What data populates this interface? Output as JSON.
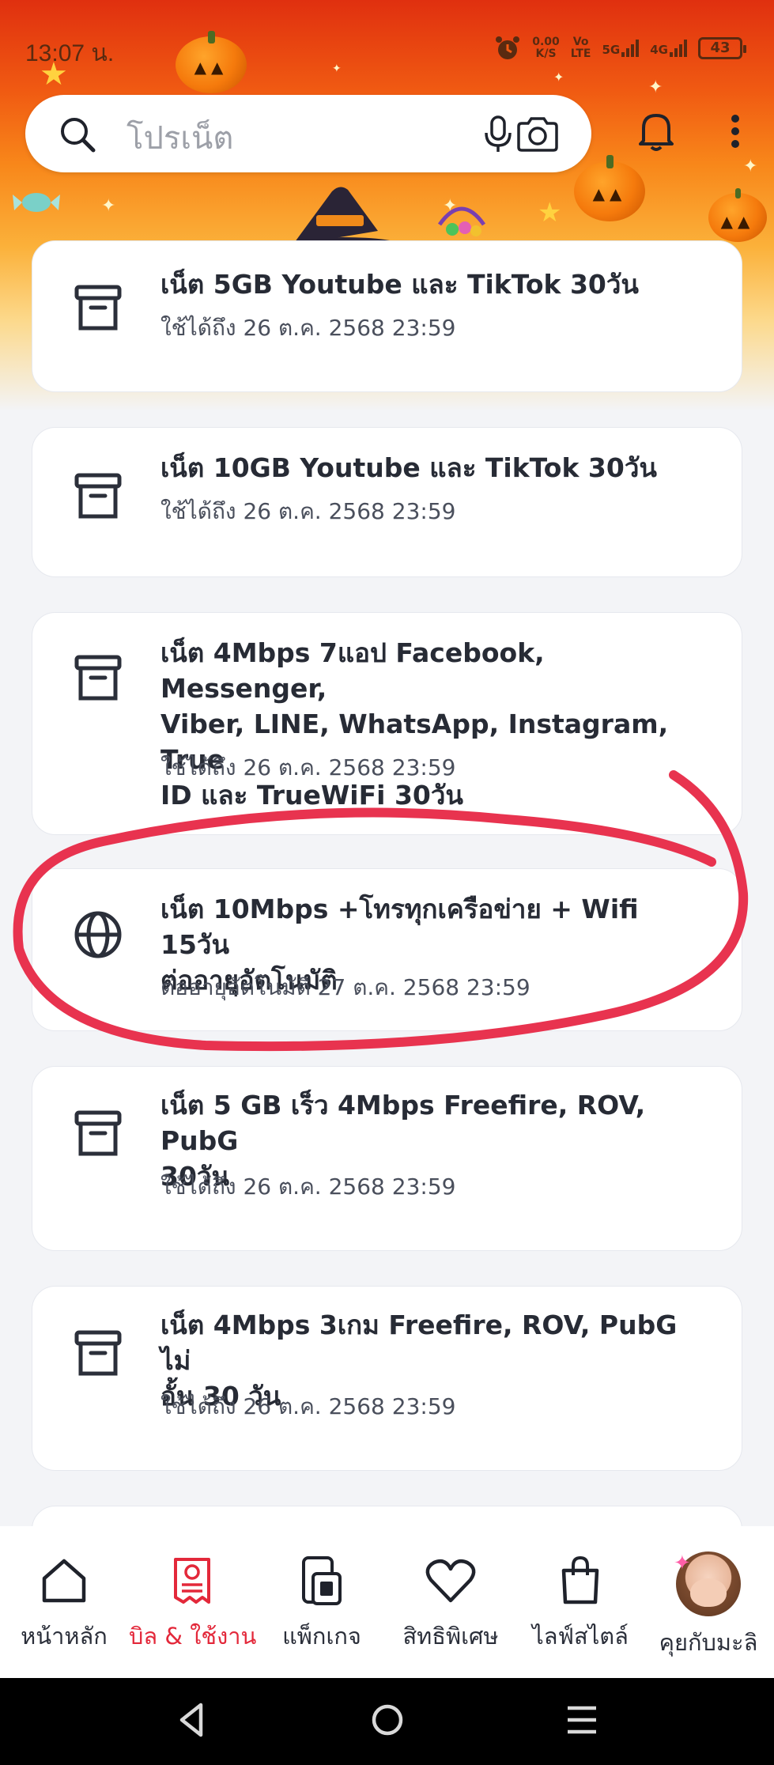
{
  "status_bar": {
    "time": "13:07 น.",
    "net_speed_value": "0.00",
    "net_speed_unit": "K/S",
    "volte_top": "Vo",
    "volte_bottom": "LTE",
    "signal_1": "5G",
    "signal_2": "4G",
    "battery": "43"
  },
  "search": {
    "placeholder": "โปรเน็ต"
  },
  "packages": [
    {
      "title": "เน็ต 5GB Youtube และ TikTok 30วัน",
      "subtitle": "ใช้ได้ถึง 26 ต.ค. 2568 23:59",
      "icon": "archive-icon"
    },
    {
      "title": "เน็ต 10GB Youtube และ TikTok 30วัน",
      "subtitle": "ใช้ได้ถึง 26 ต.ค. 2568 23:59",
      "icon": "archive-icon"
    },
    {
      "title_lines": [
        "เน็ต 4Mbps 7แอป Facebook, Messenger,",
        "Viber, LINE, WhatsApp, Instagram, True",
        "ID และ TrueWiFi 30วัน"
      ],
      "subtitle": "ใช้ได้ถึง 26 ต.ค. 2568 23:59",
      "icon": "archive-icon"
    },
    {
      "title_lines": [
        "เน็ต 10Mbps +โทรทุกเครือข่าย + Wifi 15วัน",
        "ต่ออายุอัตโนมัติ"
      ],
      "subtitle": "ต่ออายุอัตโนมัติ 27 ต.ค. 2568 23:59",
      "icon": "globe-icon",
      "highlight_color": "#e8334f"
    },
    {
      "title_lines": [
        "เน็ต 5 GB เร็ว 4Mbps Freefire, ROV, PubG",
        "30วัน"
      ],
      "subtitle": "ใช้ได้ถึง 26 ต.ค. 2568 23:59",
      "icon": "archive-icon"
    },
    {
      "title_lines": [
        "เน็ต 4Mbps 3เกม Freefire, ROV, PubG ไม่",
        "อั้น 30 วัน"
      ],
      "subtitle": "ใช้ได้ถึง 26 ต.ค. 2568 23:59",
      "icon": "archive-icon"
    }
  ],
  "bottom_nav": [
    {
      "label": "หน้าหลัก",
      "icon": "home-icon"
    },
    {
      "label": "บิล & ใช้งาน",
      "icon": "bill-icon",
      "active": true
    },
    {
      "label": "แพ็กเกจ",
      "icon": "sim-package-icon"
    },
    {
      "label": "สิทธิพิเศษ",
      "icon": "heart-icon"
    },
    {
      "label": "ไลฟ์สไตล์",
      "icon": "shopping-bag-icon"
    },
    {
      "label": "คุยกับมะลิ",
      "icon": "avatar"
    }
  ],
  "colors": {
    "accent": "#e3283a",
    "text": "#2b2f3a",
    "background": "#f3f4f7"
  }
}
